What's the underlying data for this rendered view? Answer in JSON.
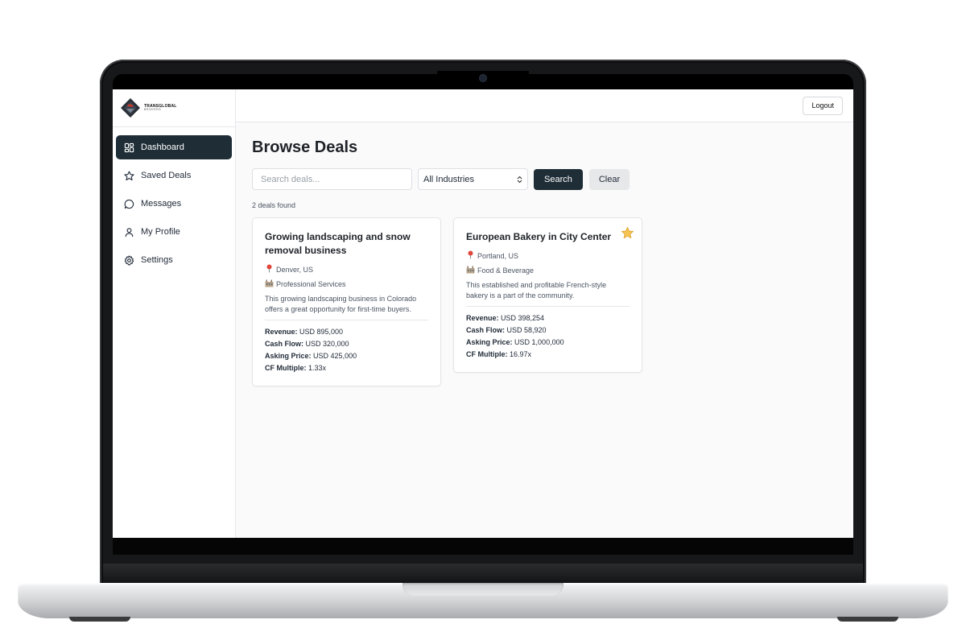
{
  "brand": {
    "name": "TRANSGLOBAL",
    "sub": "BROKERS"
  },
  "sidebar": {
    "items": [
      {
        "label": "Dashboard",
        "icon": "dashboard-grid-icon",
        "active": true
      },
      {
        "label": "Saved Deals",
        "icon": "star-icon",
        "active": false
      },
      {
        "label": "Messages",
        "icon": "chat-bubble-icon",
        "active": false
      },
      {
        "label": "My Profile",
        "icon": "user-icon",
        "active": false
      },
      {
        "label": "Settings",
        "icon": "gear-icon",
        "active": false
      }
    ]
  },
  "header": {
    "logout_label": "Logout"
  },
  "main": {
    "title": "Browse Deals",
    "search": {
      "placeholder": "Search deals...",
      "value": ""
    },
    "industry_select": {
      "selected": "All Industries"
    },
    "search_button": "Search",
    "clear_button": "Clear",
    "results_count": "2 deals found"
  },
  "deals": [
    {
      "title": "Growing landscaping and snow removal business",
      "location": "Denver, US",
      "industry": "Professional Services",
      "description": "This growing landscaping business in Colorado offers a great opportunity for first-time buyers.",
      "revenue_label": "Revenue:",
      "revenue": "USD 895,000",
      "cashflow_label": "Cash Flow:",
      "cashflow": "USD 320,000",
      "asking_label": "Asking Price:",
      "asking": "USD 425,000",
      "multiple_label": "CF Multiple:",
      "multiple": "1.33x",
      "saved": false
    },
    {
      "title": "European Bakery in City Center",
      "location": "Portland, US",
      "industry": "Food & Beverage",
      "description": "This established and profitable French-style bakery is a part of the community.",
      "revenue_label": "Revenue:",
      "revenue": "USD 398,254",
      "cashflow_label": "Cash Flow:",
      "cashflow": "USD 58,920",
      "asking_label": "Asking Price:",
      "asking": "USD 1,000,000",
      "multiple_label": "CF Multiple:",
      "multiple": "16.97x",
      "saved": true
    }
  ],
  "colors": {
    "accent": "#1f2d36",
    "star": "#f0b429",
    "pin": "#e0463a"
  }
}
